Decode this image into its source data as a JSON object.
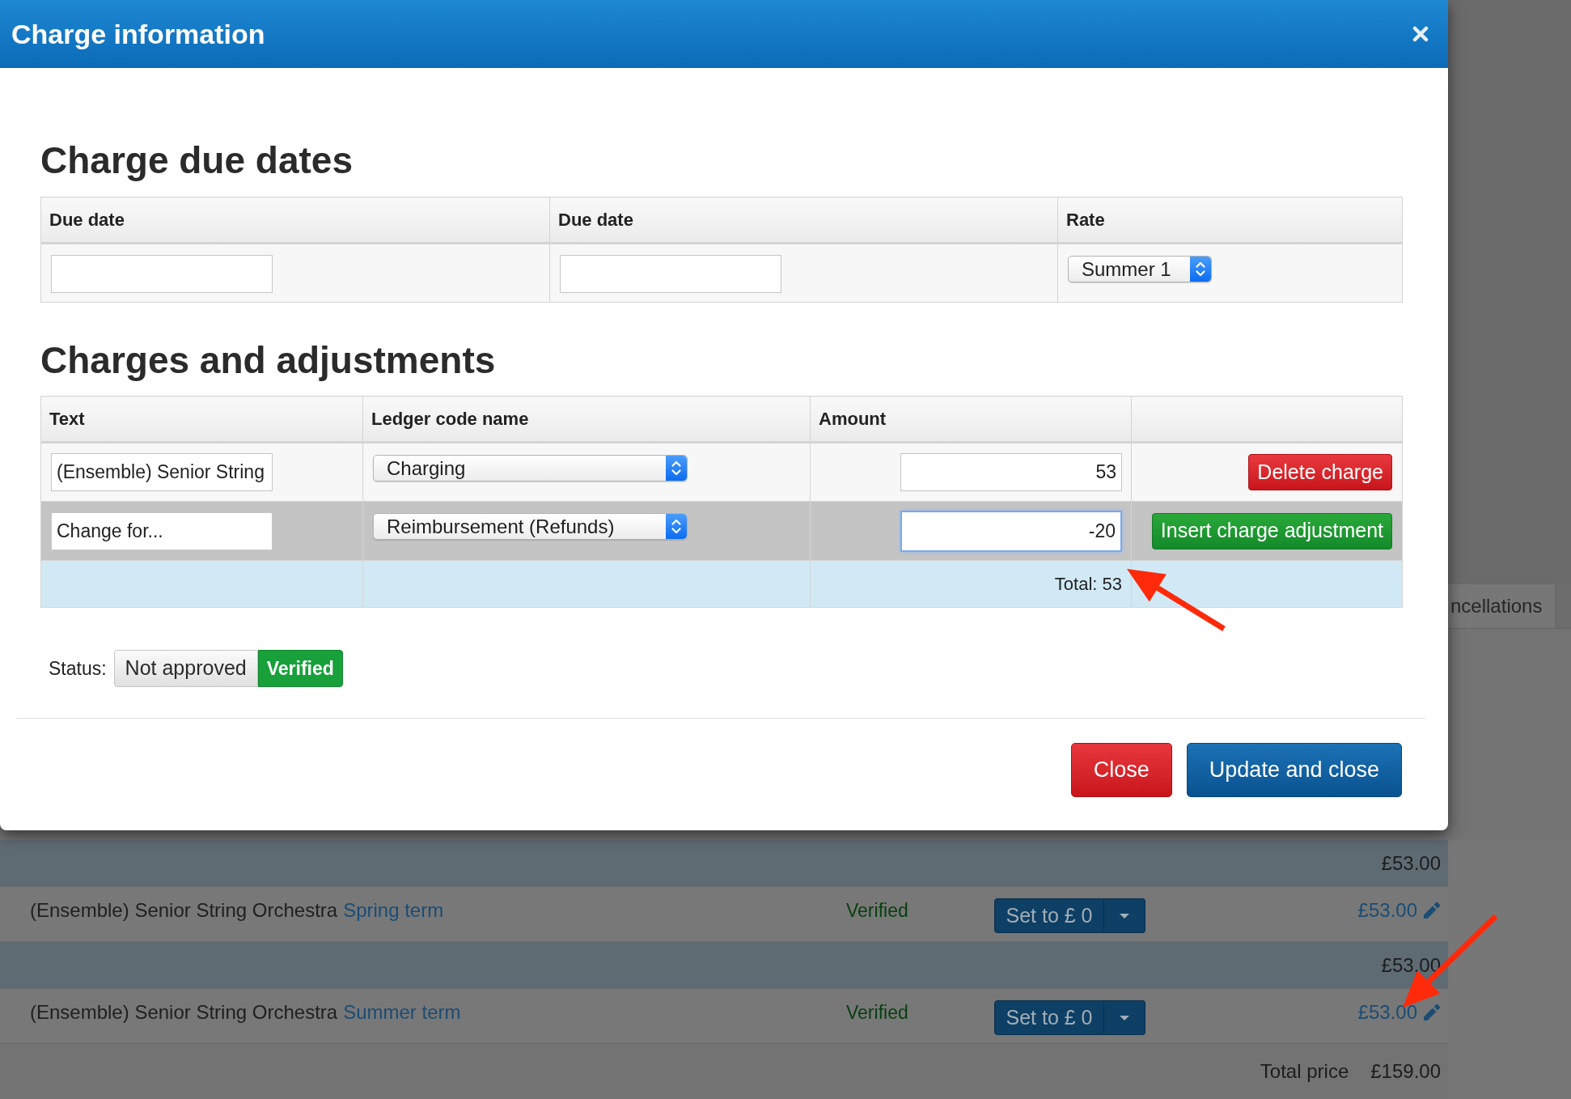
{
  "dialog": {
    "title": "Charge information",
    "due_dates": {
      "heading": "Charge due dates",
      "columns": [
        "Due date",
        "Due date",
        "Rate"
      ],
      "cells": [
        {
          "kind": "date_input"
        },
        {
          "kind": "date_input"
        },
        {
          "kind": "select",
          "value": "Summer 1"
        }
      ]
    },
    "charges": {
      "heading": "Charges and adjustments",
      "columns": [
        "Text",
        "Ledger code name",
        "Amount"
      ],
      "rows": [
        {
          "text": "(Ensemble) Senior String",
          "ledger_code": "Charging",
          "amount": "53",
          "amount_focused": false,
          "highlighted": false,
          "action": {
            "kind": "delete",
            "label": "Delete charge"
          }
        },
        {
          "text": "Change for...",
          "ledger_code": "Reimbursement (Refunds)",
          "amount": "-20",
          "amount_focused": true,
          "highlighted": true,
          "action": {
            "kind": "insert",
            "label": "Insert charge adjustment"
          }
        }
      ],
      "total": "Total: 53"
    },
    "status": {
      "label": "Status:",
      "options": [
        {
          "label": "Not approved",
          "selected": false
        },
        {
          "label": "Verified",
          "selected": true
        }
      ]
    },
    "buttons": [
      {
        "kind": "danger",
        "label": "Close"
      },
      {
        "kind": "primary",
        "label": "Update and close"
      }
    ]
  },
  "background": {
    "tab": "ncellations",
    "rows": [
      {
        "kind": "subtotal",
        "amount": "£53.00"
      },
      {
        "kind": "item",
        "description": "(Ensemble) Senior String Orchestra",
        "term": "Spring term",
        "status": "Verified",
        "button": "Set to £ 0",
        "price": "£53.00"
      },
      {
        "kind": "subtotal",
        "amount": "£53.00"
      },
      {
        "kind": "item",
        "description": "(Ensemble) Senior String Orchestra",
        "term": "Summer term",
        "status": "Verified",
        "button": "Set to £ 0",
        "price": "£53.00"
      }
    ],
    "total": {
      "label": "Total price",
      "amount": "£159.00"
    }
  }
}
